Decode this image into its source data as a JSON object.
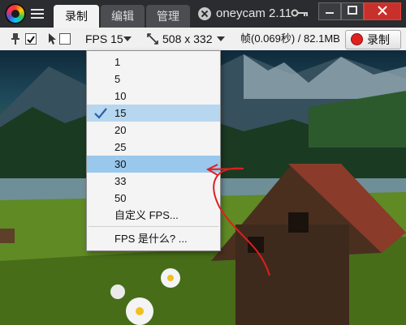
{
  "tabs": [
    {
      "label": "录制",
      "active": true
    },
    {
      "label": "编辑",
      "active": false
    },
    {
      "label": "管理",
      "active": false
    }
  ],
  "app_title": "oneycam 2.11",
  "toolbar": {
    "fps_label": "FPS 15",
    "size_label": "508 x 332",
    "frame_info": "帧(0.069秒) / 82.1MB",
    "record_label": "录制"
  },
  "fps_menu": {
    "items": [
      "1",
      "5",
      "10",
      "15",
      "20",
      "25",
      "30",
      "33",
      "50"
    ],
    "selected": "15",
    "highlighted": "30",
    "custom": "自定义 FPS...",
    "help": "FPS 是什么? ..."
  },
  "colors": {
    "accent_record": "#e02020",
    "menu_highlight": "#99c8ec",
    "menu_selected": "#b6d7ef",
    "annotation_red": "#e01e1e"
  },
  "icons": [
    "app-logo-icon",
    "menu-icon",
    "close-tab-icon",
    "key-icon",
    "minimize-icon",
    "maximize-icon",
    "close-icon",
    "pin-icon",
    "cursor-icon",
    "resize-icon",
    "dropdown-arrow-icon",
    "checkmark-icon",
    "record-dot-icon"
  ]
}
